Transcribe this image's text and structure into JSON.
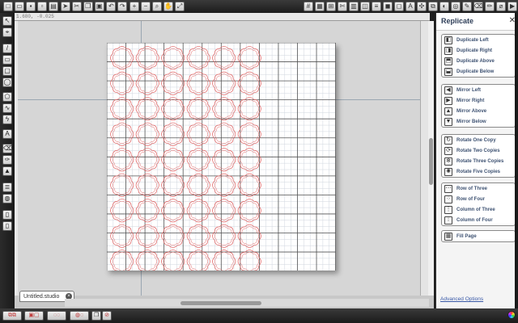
{
  "document_tab": {
    "name": "Untitled.studio"
  },
  "ruler": {
    "coord_readout": "1.680, -0.025"
  },
  "panel": {
    "title": "Replicate",
    "groups": [
      {
        "name": "duplicate",
        "items": [
          "Duplicate Left",
          "Duplicate Right",
          "Duplicate Above",
          "Duplicate Below"
        ]
      },
      {
        "name": "mirror",
        "items": [
          "Mirror Left",
          "Mirror Right",
          "Mirror Above",
          "Mirror Below"
        ]
      },
      {
        "name": "rotate",
        "items": [
          "Rotate One Copy",
          "Rotate Two Copies",
          "Rotate Three Copies",
          "Rotate Five Copies"
        ]
      },
      {
        "name": "arrange",
        "items": [
          "Row of Three",
          "Row of Four",
          "Column of Three",
          "Column of Four"
        ]
      },
      {
        "name": "fill",
        "items": [
          "Fill Page"
        ]
      }
    ],
    "advanced_link": "Advanced Options"
  },
  "toolbar_icons": [
    "new-icon",
    "open-icon",
    "save-icon",
    "save-as-icon",
    "print-icon",
    "send-icon",
    "cut-icon",
    "copy-icon",
    "paste-icon",
    "undo-icon",
    "redo-icon",
    "zoom-in-icon",
    "zoom-out-icon",
    "zoom-select-icon",
    "pan-icon",
    "zoom-fit-icon"
  ],
  "colors": {
    "accent": "#2e3e58",
    "pattern_stroke": "#e06060",
    "mat_grid": "#cfd6de",
    "mat_major": "#555555"
  },
  "pattern": {
    "columns": 6,
    "rows": 9,
    "shape": "quatrefoil-tile"
  }
}
